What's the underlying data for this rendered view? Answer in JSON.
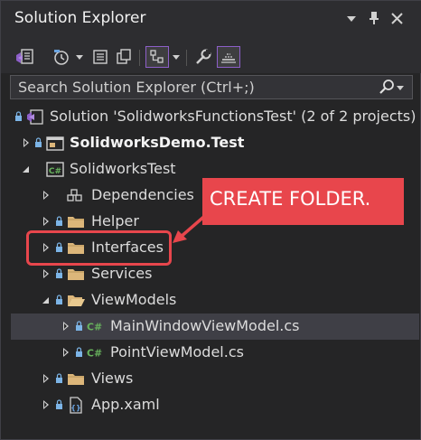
{
  "panel": {
    "title": "Solution Explorer",
    "controls": [
      "chevron-down-icon",
      "pin-icon",
      "close-icon"
    ]
  },
  "toolbar": {
    "buttons": [
      {
        "name": "home-icon"
      },
      {
        "name": "history-icon"
      },
      {
        "name": "collapse-all-icon"
      },
      {
        "name": "copy-icon"
      },
      {
        "name": "switch-views-icon"
      },
      {
        "name": "properties-icon"
      },
      {
        "name": "preview-icon"
      }
    ],
    "accent": "#8d5fc9"
  },
  "search": {
    "placeholder": "Search Solution Explorer (Ctrl+;)"
  },
  "tree": [
    {
      "label": "Solution 'SolidworksFunctionsTest' (2 of 2 projects)",
      "icon": "solution-icon",
      "expander": "none",
      "bold": false
    },
    {
      "label": "SolidworksDemo.Test",
      "icon": "project-icon",
      "expander": "collapsed",
      "bold": true
    },
    {
      "label": "SolidworksTest",
      "icon": "csharp-project-icon",
      "expander": "expanded",
      "bold": false
    },
    {
      "label": "Dependencies",
      "icon": "dependencies-icon",
      "expander": "collapsed",
      "bold": false
    },
    {
      "label": "Helper",
      "icon": "folder-icon",
      "expander": "collapsed",
      "bold": false
    },
    {
      "label": "Interfaces",
      "icon": "folder-icon",
      "expander": "collapsed",
      "bold": false
    },
    {
      "label": "Services",
      "icon": "folder-icon",
      "expander": "collapsed",
      "bold": false
    },
    {
      "label": "ViewModels",
      "icon": "folder-icon",
      "expander": "expanded",
      "bold": false
    },
    {
      "label": "MainWindowViewModel.cs",
      "icon": "csharp-file-icon",
      "expander": "collapsed",
      "bold": false,
      "selected": true
    },
    {
      "label": "PointViewModel.cs",
      "icon": "csharp-file-icon",
      "expander": "collapsed",
      "bold": false
    },
    {
      "label": "Views",
      "icon": "folder-icon",
      "expander": "collapsed",
      "bold": false
    },
    {
      "label": "App.xaml",
      "icon": "xaml-file-icon",
      "expander": "collapsed",
      "bold": false
    }
  ],
  "callout": {
    "text": "CREATE FOLDER.",
    "color": "#e8464c"
  },
  "colors": {
    "folder": "#dcb67a",
    "csharp": "#68b35d",
    "lock": "#7cb4e6"
  }
}
